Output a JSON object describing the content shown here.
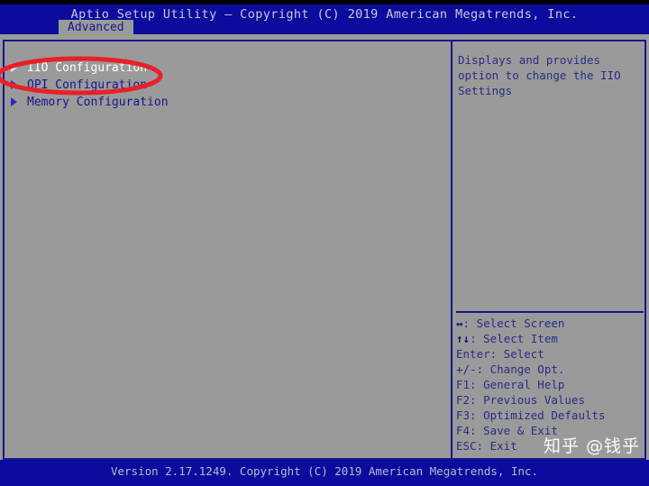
{
  "titlebar": {
    "title": "Aptio Setup Utility – Copyright (C) 2019 American Megatrends, Inc.",
    "tab_label": "Advanced"
  },
  "menu": {
    "items": [
      {
        "label": "IIO Configuration",
        "selected": true,
        "arrow_icon": "triangle-right-icon"
      },
      {
        "label": "QPI Configuration",
        "selected": false,
        "arrow_icon": "triangle-right-icon"
      },
      {
        "label": "Memory Configuration",
        "selected": false,
        "arrow_icon": "triangle-right-icon"
      }
    ]
  },
  "help": {
    "lines": [
      "Displays and provides",
      "option to change the IIO",
      "Settings"
    ]
  },
  "keys": {
    "lines": [
      {
        "glyph": "↔",
        "text": ": Select Screen"
      },
      {
        "glyph": "↑↓",
        "text": ": Select Item"
      },
      {
        "glyph": "",
        "text": "Enter: Select"
      },
      {
        "glyph": "",
        "text": "+/-: Change Opt."
      },
      {
        "glyph": "",
        "text": "F1: General Help"
      },
      {
        "glyph": "",
        "text": "F2: Previous Values"
      },
      {
        "glyph": "",
        "text": "F3: Optimized Defaults"
      },
      {
        "glyph": "",
        "text": "F4: Save & Exit"
      },
      {
        "glyph": "",
        "text": "ESC: Exit"
      }
    ]
  },
  "footer": {
    "version_text": "Version 2.17.1249. Copyright (C) 2019 American Megatrends, Inc."
  },
  "watermark": {
    "text": "知乎 @钱乎"
  },
  "annotation": {
    "shape": "ellipse",
    "color": "#e8202a",
    "target": "IIO Configuration"
  },
  "colors": {
    "titlebar_blue": "#0b0b9e",
    "panel_gray": "#9a9a9a",
    "border_blue": "#16168c",
    "text_blue": "#2b2b86",
    "selected_white": "#ffffff",
    "annotation_red": "#e8202a"
  }
}
